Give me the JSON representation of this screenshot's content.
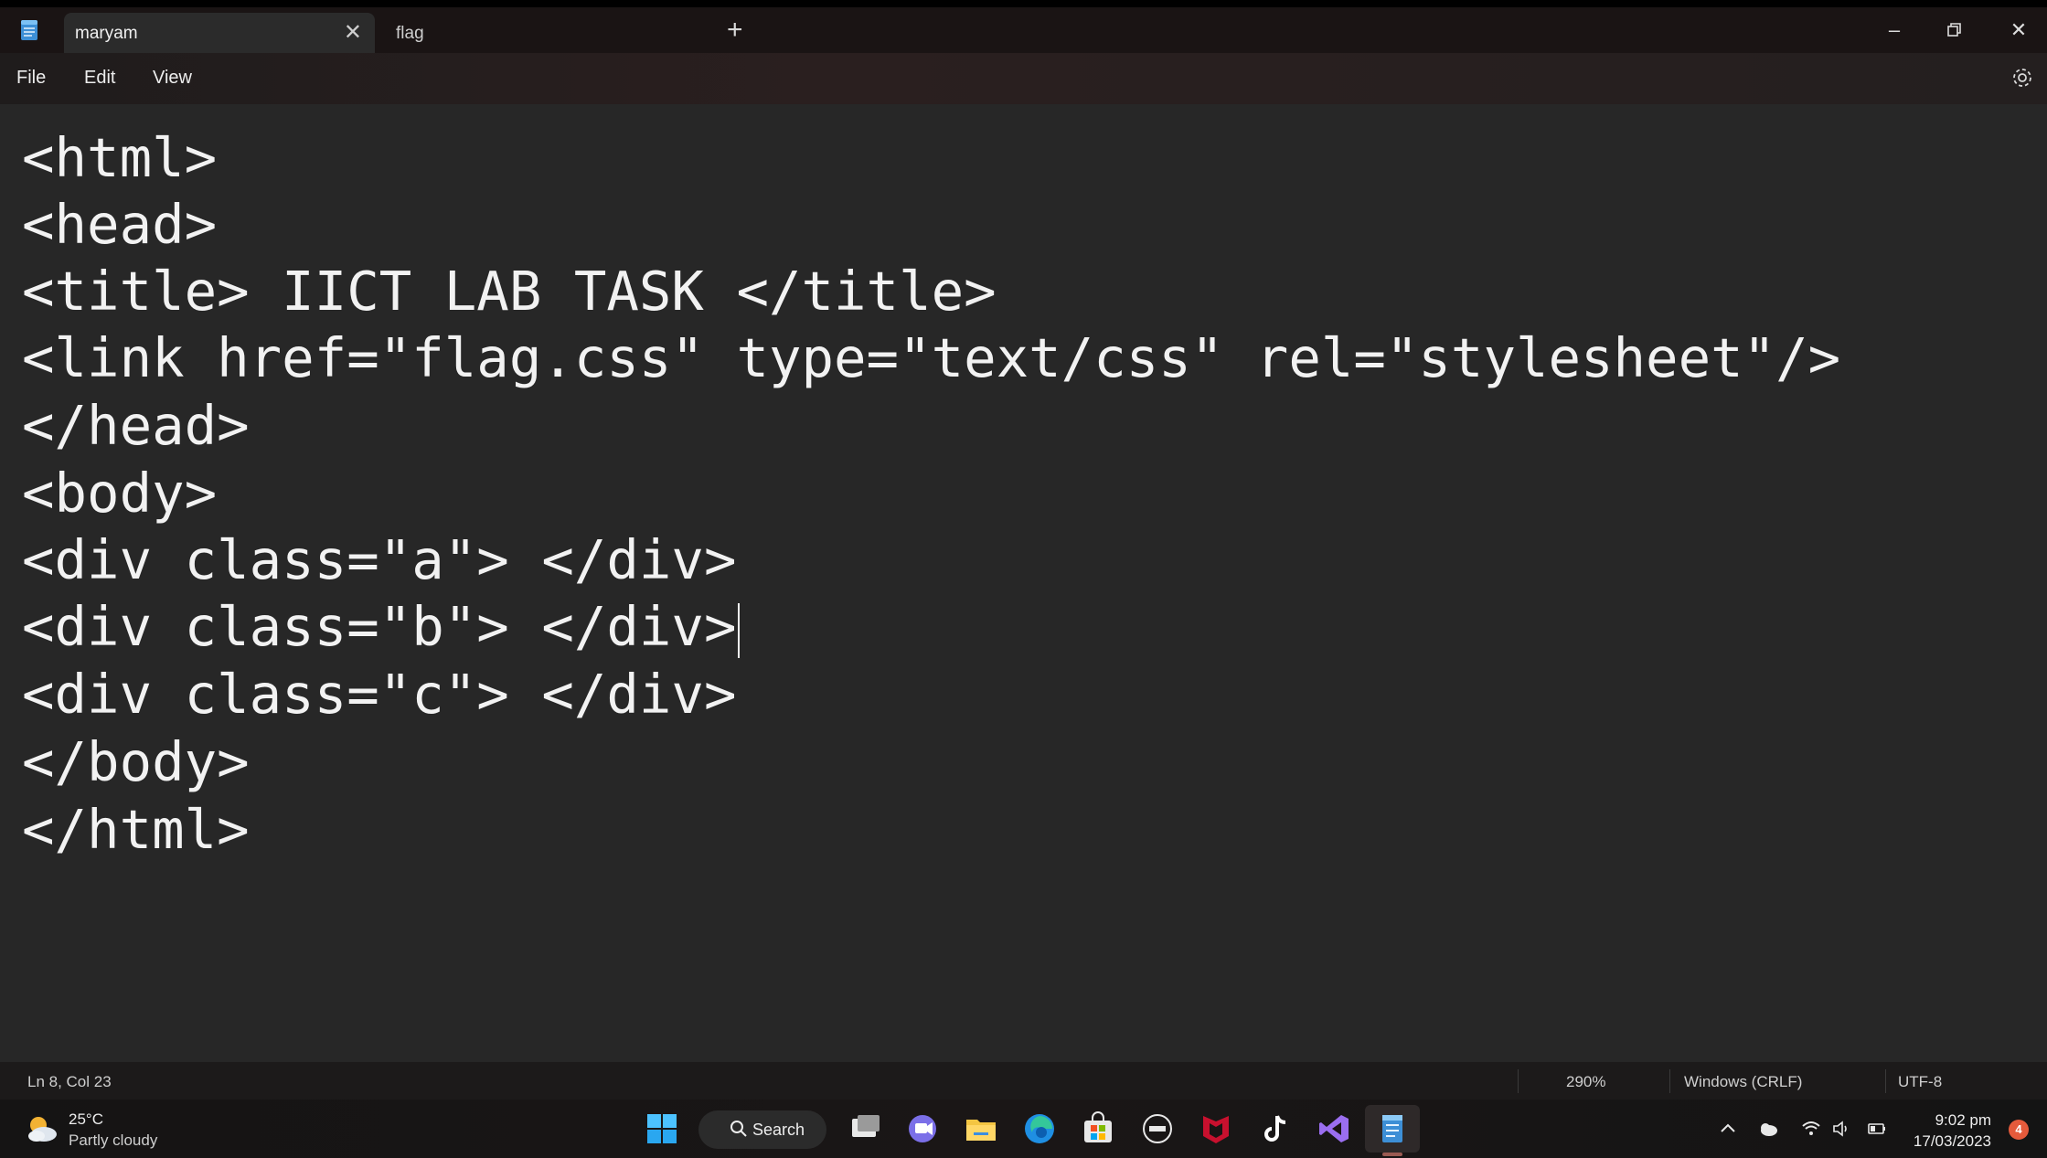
{
  "tabs": [
    {
      "label": "maryam",
      "active": true
    },
    {
      "label": "flag",
      "active": false
    }
  ],
  "menu": [
    "File",
    "Edit",
    "View"
  ],
  "code_lines": [
    "<html>",
    "<head>",
    "<title> IICT LAB TASK </title>",
    "<link href=\"flag.css\" type=\"text/css\" rel=\"stylesheet\"/>",
    "</head>",
    "<body>",
    "<div class=\"a\"> </div>",
    "<div class=\"b\"> </div>",
    "<div class=\"c\"> </div>",
    "</body>",
    "</html>"
  ],
  "status": {
    "position": "Ln 8, Col 23",
    "zoom": "290%",
    "line_endings": "Windows (CRLF)",
    "encoding": "UTF-8"
  },
  "taskbar": {
    "weather_temp": "25°C",
    "weather_desc": "Partly cloudy",
    "search_label": "Search",
    "time": "9:02 pm",
    "date": "17/03/2023",
    "notification_count": "4"
  },
  "colors": {
    "editor_bg": "#272727",
    "text": "#f2f2f2",
    "titlebar_bg": "#1a1414",
    "accent_notepad": "#4aa3e8"
  }
}
